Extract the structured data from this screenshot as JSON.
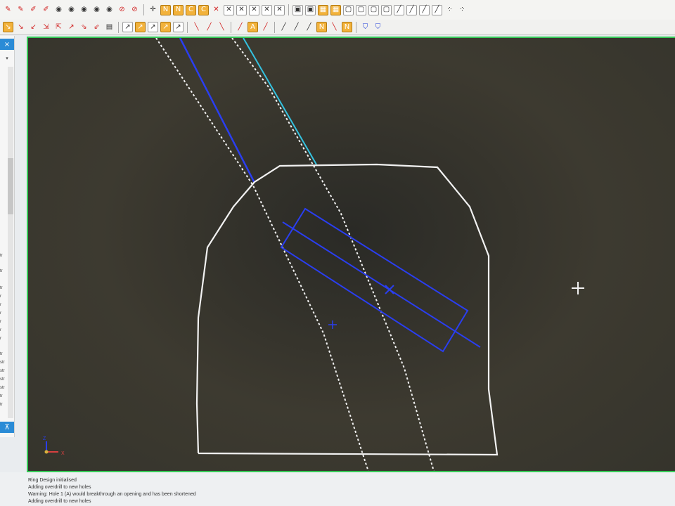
{
  "viewport": {
    "axis_labels": {
      "z": "Z",
      "x": "X"
    },
    "colors": {
      "background": "#35342c",
      "drive_outline": "#f2f2f2",
      "design_lines": "#2a3ef0",
      "reference_line": "#34c2e0",
      "viewport_border": "#36c957"
    }
  },
  "side_panel": {
    "close_glyph": "×",
    "pin_glyph": "⊼",
    "dropdown_glyph": "▾",
    "items": [
      "tr",
      "tr",
      "tr",
      "r",
      "r",
      "r",
      "r",
      "r",
      "r",
      "tr",
      "str",
      "str",
      "str",
      "str",
      "tr",
      "tr"
    ]
  },
  "message_log": {
    "lines": [
      "Ring Design initialised",
      "Adding overdrill to new holes",
      "Warning: Hole 1 (A) would breakthrough an opening and has been shortened",
      "Adding overdrill to new holes"
    ]
  },
  "toolbar_icons": {
    "row1": [
      "pen-icon",
      "pen-icon",
      "edit-icon",
      "edit-icon",
      "eye-icon",
      "eye-icon",
      "eye-icon",
      "eye-icon",
      "eye-icon",
      "hide-icon",
      "select-icon",
      "move-icon",
      "snap-icon",
      "snap-icon",
      "snap-icon",
      "snap-icon",
      "delete-icon",
      "delete-icon",
      "delete-icon",
      "delete-icon",
      "delete-icon",
      "grid-icon",
      "grid-icon",
      "grid-icon",
      "grid-icon",
      "line-icon",
      "line-icon",
      "line-icon"
    ],
    "row2": [
      "draw-icon",
      "draw-icon",
      "draw-icon",
      "draw-icon",
      "edit-icon",
      "edit-icon",
      "edit-icon",
      "line-icon",
      "line-icon",
      "line-icon",
      "line-icon",
      "line-icon",
      "line-icon",
      "text-icon",
      "text-icon",
      "text-icon",
      "shield-icon",
      "shield-icon"
    ]
  }
}
